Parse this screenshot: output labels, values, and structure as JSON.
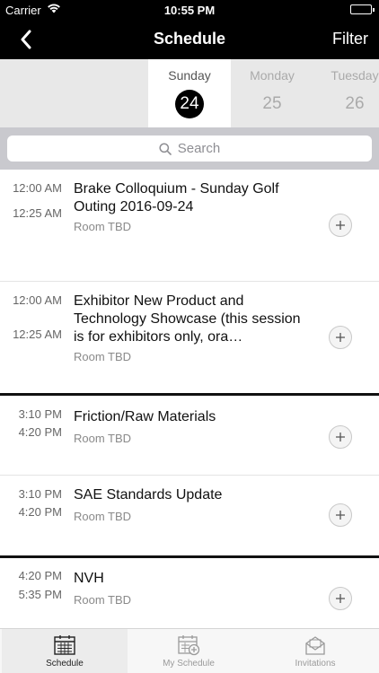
{
  "status_bar": {
    "carrier": "Carrier",
    "time": "10:55 PM"
  },
  "nav": {
    "title": "Schedule",
    "filter_label": "Filter"
  },
  "days": [
    {
      "name": "Sunday",
      "number": "24",
      "selected": true
    },
    {
      "name": "Monday",
      "number": "25",
      "selected": false
    },
    {
      "name": "Tuesday",
      "number": "26",
      "selected": false
    }
  ],
  "search": {
    "placeholder": "Search"
  },
  "sessions": [
    {
      "start": "12:00 AM",
      "end": "12:25 AM",
      "title": "Brake Colloquium - Sunday Golf Outing 2016-09-24",
      "room": "Room TBD"
    },
    {
      "start": "12:00 AM",
      "end": "12:25 AM",
      "title": "Exhibitor New Product and Technology Showcase (this session is for exhibitors only, ora…",
      "room": "Room TBD"
    },
    {
      "start": "3:10 PM",
      "end": "4:20 PM",
      "title": "Friction/Raw Materials",
      "room": "Room TBD"
    },
    {
      "start": "3:10 PM",
      "end": "4:20 PM",
      "title": "SAE Standards Update",
      "room": "Room TBD"
    },
    {
      "start": "4:20 PM",
      "end": "5:35 PM",
      "title": "NVH",
      "room": "Room TBD"
    }
  ],
  "tabs": [
    {
      "label": "Schedule",
      "icon": "calendar-icon",
      "active": true
    },
    {
      "label": "My Schedule",
      "icon": "calendar-add-icon",
      "active": false
    },
    {
      "label": "Invitations",
      "icon": "envelope-icon",
      "active": false
    }
  ],
  "colors": {
    "header_bg": "#000000",
    "day_strip_bg": "#e8e8e8",
    "search_strip_bg": "#c9c9ce",
    "selected_day_badge": "#000000"
  }
}
